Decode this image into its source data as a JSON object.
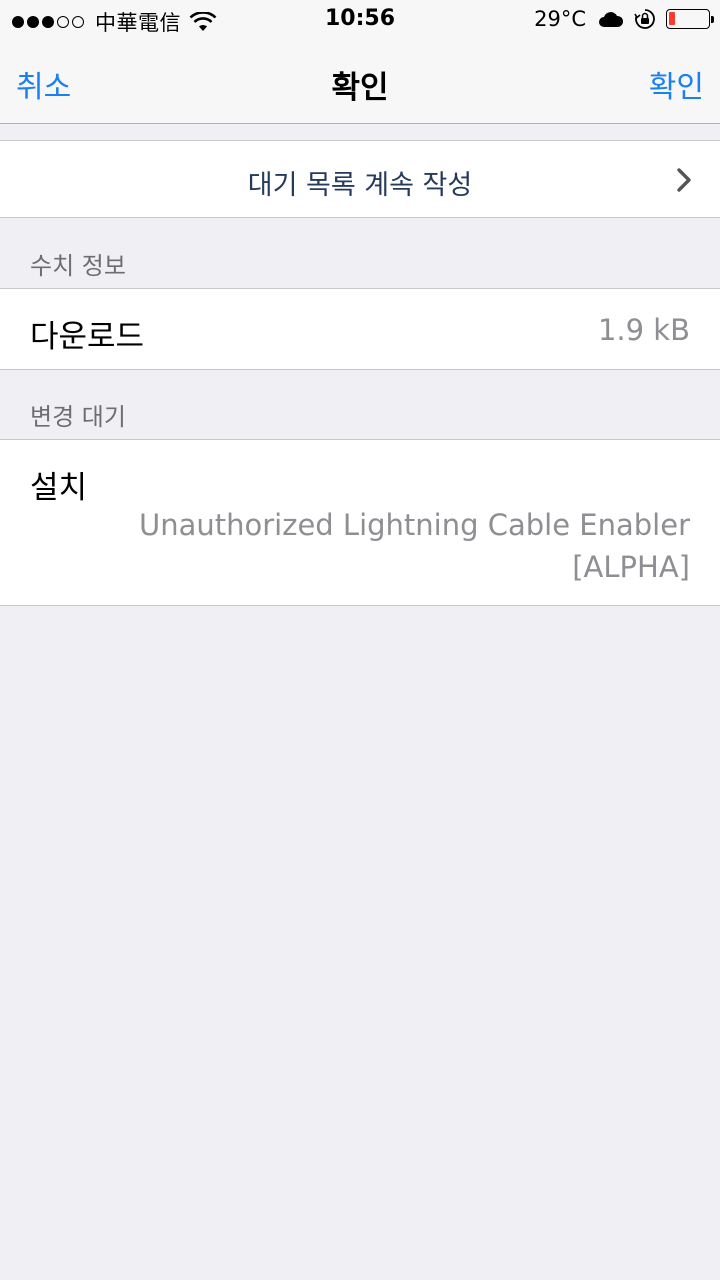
{
  "status_bar": {
    "signal_dots": [
      "filled",
      "filled",
      "filled",
      "empty",
      "empty"
    ],
    "carrier": "中華電信",
    "wifi_icon": "wifi-icon",
    "time": "10:56",
    "temperature": "29°C",
    "weather_icon": "cloud-icon",
    "rotation_lock_icon": "rotation-lock-icon",
    "battery_level": 0.15,
    "battery_color": "#ff3b30"
  },
  "nav": {
    "cancel_label": "취소",
    "title": "확인",
    "confirm_label": "확인",
    "accent_color": "#1a7ff0"
  },
  "continue_queue": {
    "label": "대기 목록 계속 작성",
    "chevron_icon": "chevron-right-icon"
  },
  "sections": {
    "stats_header": "수치 정보",
    "download": {
      "label": "다운로드",
      "value": "1.9 kB"
    },
    "pending_header": "변경 대기",
    "install": {
      "label": "설치",
      "value": "Unauthorized Lightning Cable Enabler [ALPHA]"
    }
  }
}
